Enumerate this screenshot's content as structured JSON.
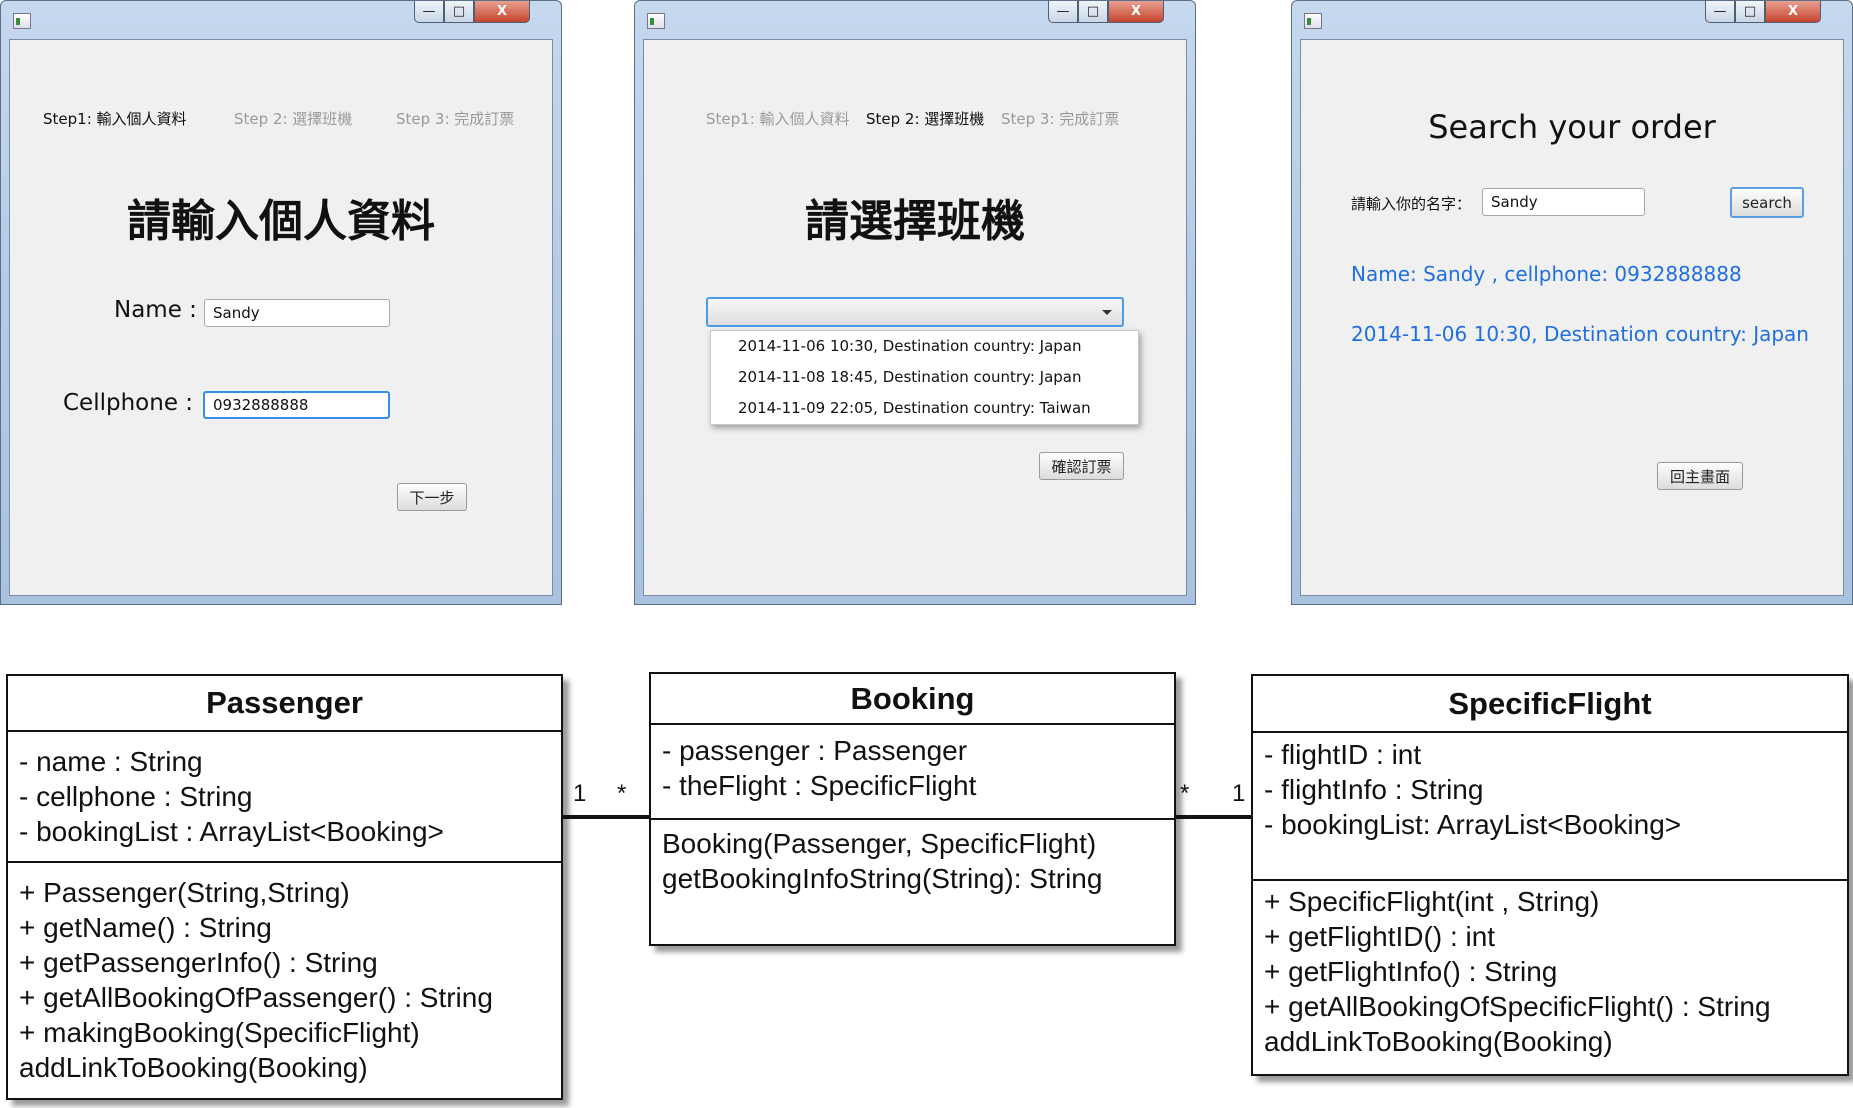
{
  "window1": {
    "steps": [
      "Step1: 輸入個人資料",
      "Step 2: 選擇班機",
      "Step 3: 完成訂票"
    ],
    "heading": "請輸入個人資料",
    "name_label": "Name :",
    "name_value": "Sandy",
    "cellphone_label": "Cellphone :",
    "cellphone_value": "0932888888",
    "next_button": "下一步",
    "controls": {
      "minimize": "—",
      "maximize": "□",
      "close": "X"
    }
  },
  "window2": {
    "steps": [
      "Step1: 輸入個人資料",
      "Step 2: 選擇班機",
      "Step 3: 完成訂票"
    ],
    "heading": "請選擇班機",
    "flight_options": [
      "2014-11-06 10:30, Destination country: Japan",
      "2014-11-08 18:45, Destination country: Japan",
      "2014-11-09 22:05, Destination country: Taiwan"
    ],
    "confirm_button": "確認訂票",
    "controls": {
      "minimize": "—",
      "maximize": "□",
      "close": "X"
    }
  },
  "window3": {
    "title": "Search your order",
    "name_prompt": "請輸入你的名字：",
    "name_value": "Sandy",
    "search_button": "search",
    "result_name": "Name: Sandy , cellphone: 0932888888",
    "result_flight": "2014-11-06 10:30, Destination country: Japan",
    "home_button": "回主畫面",
    "controls": {
      "minimize": "—",
      "maximize": "□",
      "close": "X"
    },
    "accent_color": "#1f6fe0"
  },
  "uml": {
    "passenger": {
      "name": "Passenger",
      "attributes": [
        "- name : String",
        "- cellphone : String",
        "- bookingList : ArrayList<Booking>"
      ],
      "methods": [
        "+ Passenger(String,String)",
        "+ getName() : String",
        "+ getPassengerInfo() : String",
        "+ getAllBookingOfPassenger() : String",
        "+ makingBooking(SpecificFlight)",
        "addLinkToBooking(Booking)"
      ]
    },
    "booking": {
      "name": "Booking",
      "attributes": [
        "- passenger : Passenger",
        "- theFlight : SpecificFlight"
      ],
      "methods": [
        "Booking(Passenger, SpecificFlight)",
        "getBookingInfoString(String): String"
      ]
    },
    "specific_flight": {
      "name": "SpecificFlight",
      "attributes": [
        "- flightID : int",
        "- flightInfo : String",
        "- bookingList: ArrayList<Booking>"
      ],
      "methods": [
        "+ SpecificFlight(int , String)",
        "+ getFlightID() : int",
        "+ getFlightInfo() : String",
        "+ getAllBookingOfSpecificFlight() : String",
        "addLinkToBooking(Booking)"
      ]
    },
    "multiplicities": {
      "passenger_side": "1",
      "booking_left": "*",
      "booking_right": "*",
      "flight_side": "1"
    }
  }
}
